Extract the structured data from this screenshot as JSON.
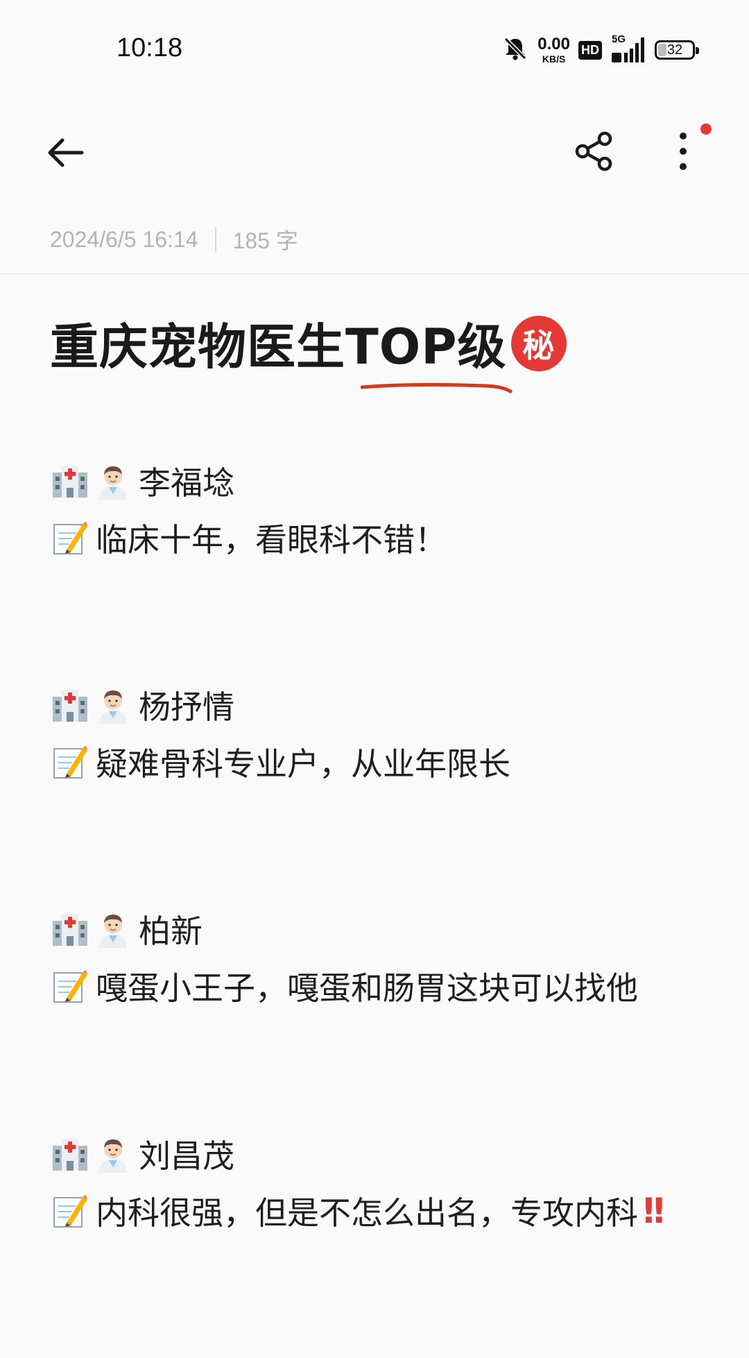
{
  "status_bar": {
    "time": "10:18",
    "net_speed_value": "0.00",
    "net_speed_unit": "KB/S",
    "hd_label": "HD",
    "network_label": "5G",
    "battery_level": "32"
  },
  "meta": {
    "datetime": "2024/6/5 16:14",
    "word_count": "185 字"
  },
  "note": {
    "title": "重庆宠物医生TOP级",
    "title_badge": "秘",
    "entries": [
      {
        "name": "李福埝",
        "desc": "临床十年，看眼科不错！"
      },
      {
        "name": "杨抒情",
        "desc": "疑难骨科专业户，从业年限长"
      },
      {
        "name": "柏新",
        "desc": "嘎蛋小王子，嘎蛋和肠胃这块可以找他"
      },
      {
        "name": "刘昌茂",
        "desc": "内科很强，但是不怎么出名，专攻内科",
        "emphasis": "!!"
      }
    ]
  },
  "icons": {
    "back": "arrow-left-icon",
    "share": "share-icon",
    "more": "more-vertical-icon",
    "hospital": "hospital-emoji-icon",
    "doctor": "doctor-emoji-icon",
    "memo": "memo-emoji-icon"
  },
  "colors": {
    "accent_red": "#e53935",
    "meta_gray": "#b3b3b3",
    "background": "#fafafa"
  }
}
